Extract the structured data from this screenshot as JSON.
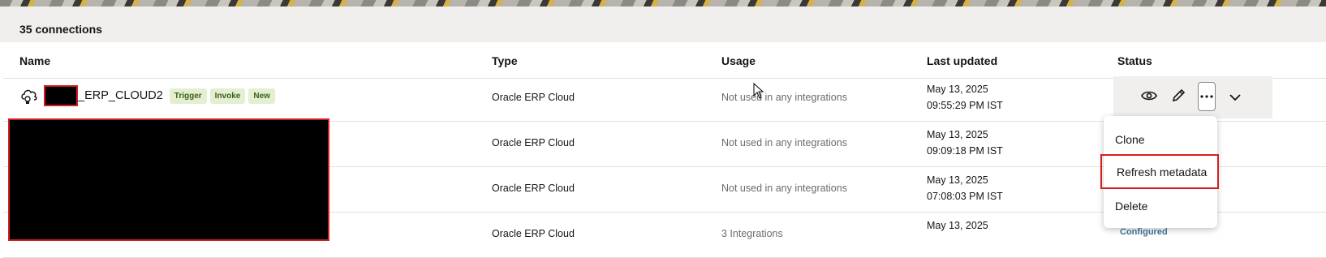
{
  "summary": {
    "count_text": "35 connections"
  },
  "table": {
    "headers": {
      "name": "Name",
      "type": "Type",
      "usage": "Usage",
      "last_updated": "Last updated",
      "status": "Status"
    },
    "rows": [
      {
        "name_suffix": "_ERP_CLOUD2",
        "badges": [
          "Trigger",
          "Invoke",
          "New"
        ],
        "type": "Oracle ERP Cloud",
        "usage": "Not used in any integrations",
        "date": "May 13, 2025",
        "time": "09:55:29 PM IST"
      },
      {
        "type": "Oracle ERP Cloud",
        "usage": "Not used in any integrations",
        "date": "May 13, 2025",
        "time": "09:09:18 PM IST"
      },
      {
        "type": "Oracle ERP Cloud",
        "usage": "Not used in any integrations",
        "date": "May 13, 2025",
        "time": "07:08:03 PM IST"
      },
      {
        "type": "Oracle ERP Cloud",
        "usage": "3 Integrations",
        "date": "May 13, 2025",
        "status": "Configured"
      }
    ]
  },
  "row_actions": {
    "icons": [
      "eye-icon",
      "pencil-icon",
      "more-icon",
      "chevron-down-icon"
    ]
  },
  "actions_menu": {
    "items": [
      "Clone",
      "Refresh metadata",
      "Delete"
    ]
  },
  "colors": {
    "badge_bg": "#e3efd0",
    "badge_text": "#3d5f1c",
    "highlight_border": "#d21f1f",
    "redaction": "#000000"
  }
}
